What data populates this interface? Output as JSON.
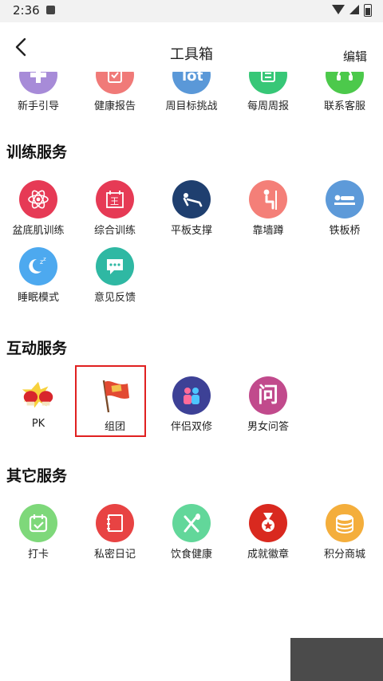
{
  "status": {
    "time": "2:36"
  },
  "header": {
    "title": "工具箱",
    "edit": "编辑"
  },
  "top_row": [
    {
      "label": "新手引导",
      "icon": "guide-icon",
      "color": "#a78bd8"
    },
    {
      "label": "健康报告",
      "icon": "report-icon",
      "color": "#f07a78"
    },
    {
      "label": "周目标挑战",
      "icon": "challenge-icon",
      "color": "#5a98d8"
    },
    {
      "label": "每周周报",
      "icon": "weekly-report-icon",
      "color": "#37c777"
    },
    {
      "label": "联系客服",
      "icon": "customer-service-icon",
      "color": "#4cc94b"
    }
  ],
  "sections": {
    "training": {
      "title": "训练服务",
      "items": [
        {
          "label": "盆底肌训练",
          "icon": "atom-icon",
          "color": "#e63a55"
        },
        {
          "label": "综合训练",
          "icon": "training-icon",
          "color": "#e63a55"
        },
        {
          "label": "平板支撑",
          "icon": "plank-icon",
          "color": "#1f3f6f"
        },
        {
          "label": "靠墙蹲",
          "icon": "wall-squat-icon",
          "color": "#f47f78"
        },
        {
          "label": "铁板桥",
          "icon": "bridge-icon",
          "color": "#5d9ad9"
        },
        {
          "label": "睡眠模式",
          "icon": "moon-icon",
          "color": "#4da9ef"
        },
        {
          "label": "意见反馈",
          "icon": "feedback-icon",
          "color": "#2fb8a3"
        }
      ]
    },
    "interactive": {
      "title": "互动服务",
      "items": [
        {
          "label": "PK",
          "icon": "boxing-gloves-icon",
          "color": "#ffffff"
        },
        {
          "label": "组团",
          "icon": "flag-icon",
          "color": "#ffffff"
        },
        {
          "label": "伴侣双修",
          "icon": "couple-icon",
          "color": "#3d4196"
        },
        {
          "label": "男女问答",
          "icon": "question-icon",
          "color": "#c14a8c",
          "glyph": "问"
        }
      ]
    },
    "other": {
      "title": "其它服务",
      "items": [
        {
          "label": "打卡",
          "icon": "checkin-calendar-icon",
          "color": "#7ed87a"
        },
        {
          "label": "私密日记",
          "icon": "diary-icon",
          "color": "#e84343"
        },
        {
          "label": "饮食健康",
          "icon": "diet-icon",
          "color": "#62d79a"
        },
        {
          "label": "成就徽章",
          "icon": "medal-icon",
          "color": "#d9291f"
        },
        {
          "label": "积分商城",
          "icon": "coins-icon",
          "color": "#f4ae3c"
        }
      ]
    }
  }
}
